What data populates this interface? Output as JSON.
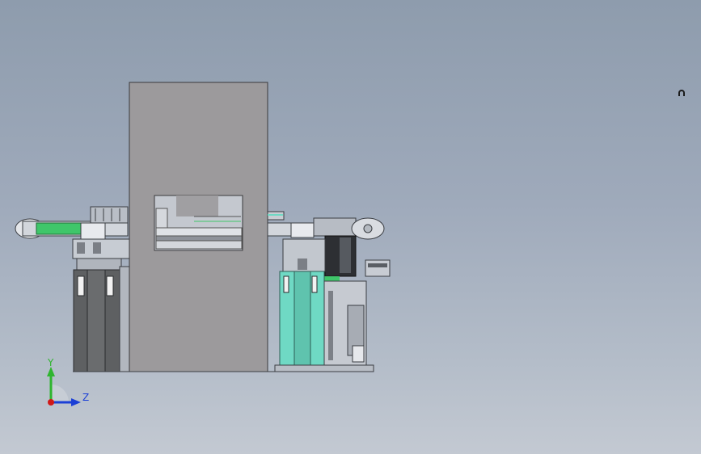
{
  "view": {
    "background_top": "#8e9cad",
    "background_bottom": "#c3c9d2"
  },
  "model": {
    "enclosure_color": "#9c9a9c",
    "cylinder_dark_color": "#5e6062",
    "cylinder_light_color": "#6fd9c4",
    "conveyor_accent_color": "#3fc66a"
  },
  "triad": {
    "y_label": "Y",
    "z_label": "Z",
    "y_color": "#2fb52f",
    "z_color": "#1b3fd6",
    "origin_color": "#d01818"
  },
  "icons": {
    "cursor": "rotate-cursor-icon"
  }
}
